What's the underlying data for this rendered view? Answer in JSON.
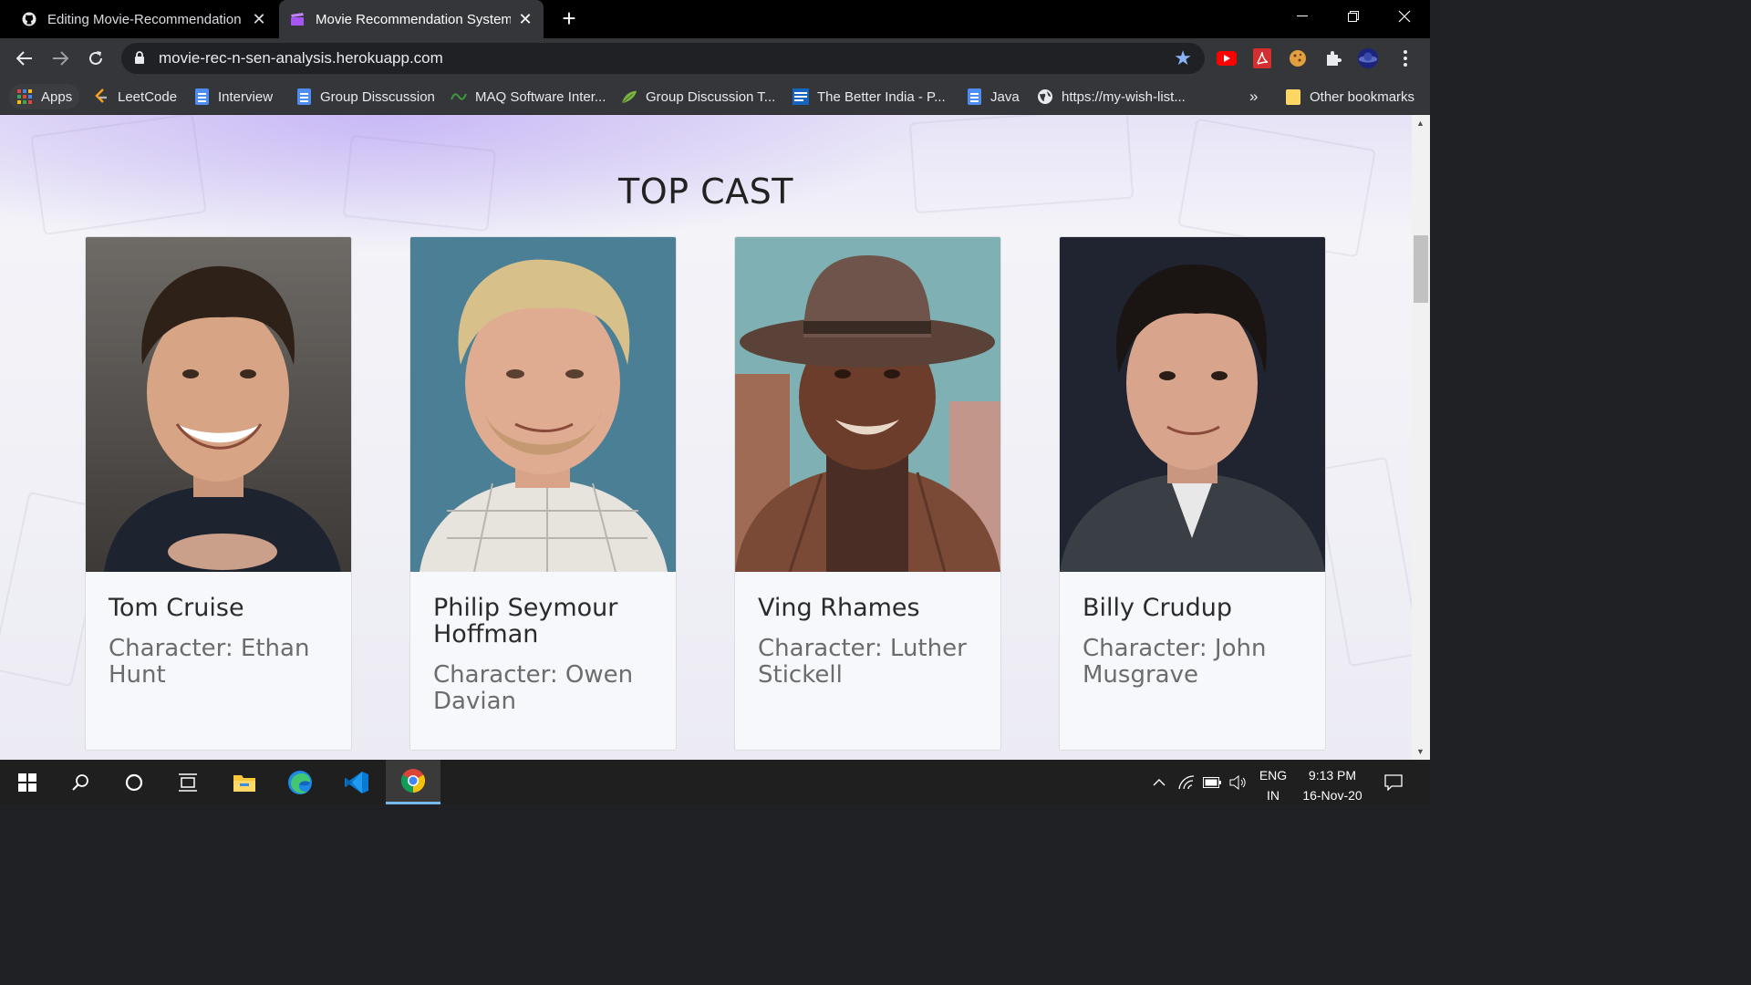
{
  "browser": {
    "tabs": [
      {
        "title": "Editing Movie-Recommendation",
        "active": false
      },
      {
        "title": "Movie Recommendation System",
        "active": true
      }
    ],
    "url": "movie-rec-n-sen-analysis.herokuapp.com",
    "bookmarks": [
      {
        "label": "Apps",
        "icon": "apps-grid-icon"
      },
      {
        "label": "LeetCode",
        "icon": "leetcode-icon"
      },
      {
        "label": "Interview",
        "icon": "google-docs-icon"
      },
      {
        "label": "Group Disscussion",
        "icon": "google-docs-icon"
      },
      {
        "label": "MAQ Software Inter...",
        "icon": "maq-icon"
      },
      {
        "label": "Group Discussion T...",
        "icon": "leaf-icon"
      },
      {
        "label": "The Better India - P...",
        "icon": "better-india-icon"
      },
      {
        "label": "Java",
        "icon": "google-docs-icon"
      },
      {
        "label": "https://my-wish-list...",
        "icon": "globe-icon"
      }
    ],
    "overflow_label": "»",
    "other_bookmarks": "Other bookmarks"
  },
  "page": {
    "section_title": "TOP CAST",
    "cast": [
      {
        "name": "Tom Cruise",
        "character": "Character: Ethan Hunt"
      },
      {
        "name": "Philip Seymour Hoffman",
        "character": "Character: Owen Davian"
      },
      {
        "name": "Ving Rhames",
        "character": "Character: Luther Stickell"
      },
      {
        "name": "Billy Crudup",
        "character": "Character: John Musgrave"
      }
    ]
  },
  "taskbar": {
    "language": "ENG",
    "region": "IN",
    "time": "9:13 PM",
    "date": "16-Nov-20"
  },
  "colors": {
    "accent_star": "#8ab4f8",
    "taskbar_active": "#76b9ed"
  }
}
